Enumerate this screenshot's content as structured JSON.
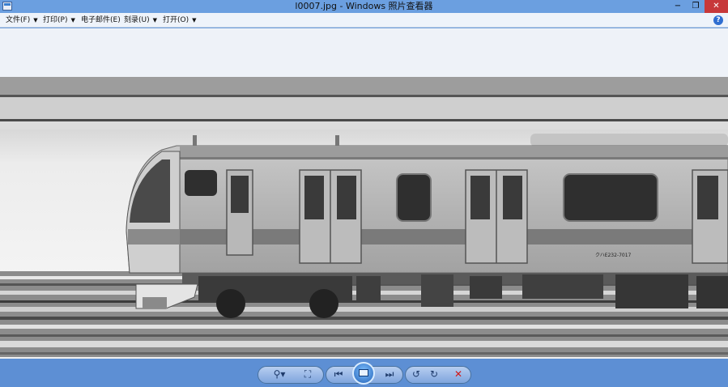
{
  "window": {
    "title": "l0007.jpg - Windows 照片查看器",
    "min_label": "−",
    "restore_label": "❐",
    "close_label": "✕"
  },
  "menu": {
    "items": [
      {
        "label": "文件(F)"
      },
      {
        "label": "打印(P)"
      },
      {
        "label": "电子邮件(E)"
      },
      {
        "label": "刻录(U)"
      },
      {
        "label": "打开(O)"
      }
    ],
    "help_label": "?"
  },
  "photo": {
    "car_number": "クハE232-7017"
  },
  "toolbar": {
    "zoom_label": "⚲▾",
    "fit_label": "⛶",
    "prev_label": "⏮",
    "next_label": "⏭",
    "rotate_ccw_label": "↺",
    "rotate_cw_label": "↻",
    "delete_label": "✕"
  }
}
